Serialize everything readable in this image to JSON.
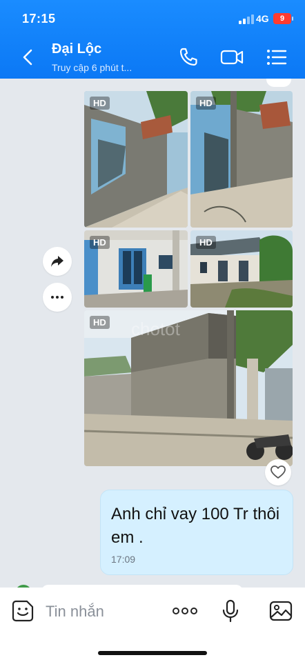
{
  "status_bar": {
    "time": "17:15",
    "network": "4G",
    "battery": "9"
  },
  "header": {
    "name": "Đại Lộc",
    "status": "Truy cập 6 phút t..."
  },
  "photos": {
    "hd_label": "HD",
    "watermark": "chotot"
  },
  "message": {
    "text": "Anh chỉ vay 100 Tr thôi em .",
    "time": "17:09"
  },
  "input": {
    "placeholder": "Tin nhắn"
  },
  "colors": {
    "header": "#0b78f5",
    "bubble": "#d5f0ff",
    "chat_bg": "#e4e8ed",
    "battery": "#ff3b30"
  }
}
